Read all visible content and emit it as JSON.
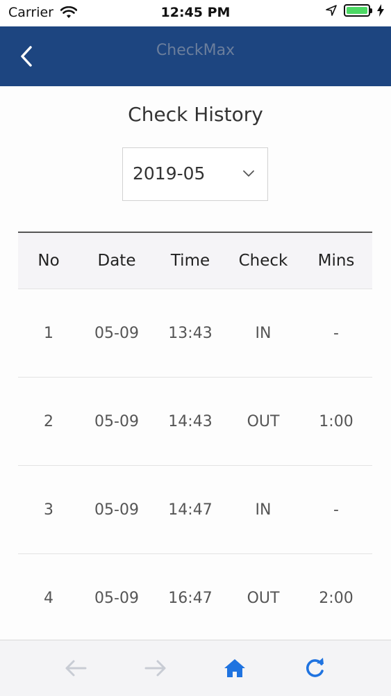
{
  "status_bar": {
    "carrier": "Carrier",
    "time": "12:45 PM",
    "battery_level": 1.0,
    "battery_color": "#4cd964"
  },
  "nav": {
    "title": "CheckMax",
    "background": "#1d4580",
    "back_icon": "chevron-left-icon"
  },
  "page": {
    "title": "Check History"
  },
  "month_select": {
    "value": "2019-05",
    "icon": "chevron-down-icon"
  },
  "table": {
    "headers": [
      "No",
      "Date",
      "Time",
      "Check",
      "Mins"
    ],
    "rows": [
      {
        "no": "1",
        "date": "05-09",
        "time": "13:43",
        "check": "IN",
        "mins": "-"
      },
      {
        "no": "2",
        "date": "05-09",
        "time": "14:43",
        "check": "OUT",
        "mins": "1:00"
      },
      {
        "no": "3",
        "date": "05-09",
        "time": "14:47",
        "check": "IN",
        "mins": "-"
      },
      {
        "no": "4",
        "date": "05-09",
        "time": "16:47",
        "check": "OUT",
        "mins": "2:00"
      }
    ]
  },
  "toolbar": {
    "back_icon": "arrow-left-icon",
    "forward_icon": "arrow-right-icon",
    "home_icon": "home-icon",
    "refresh_icon": "refresh-icon",
    "active_color": "#1f73e0",
    "disabled_color": "#c8ccd4"
  }
}
